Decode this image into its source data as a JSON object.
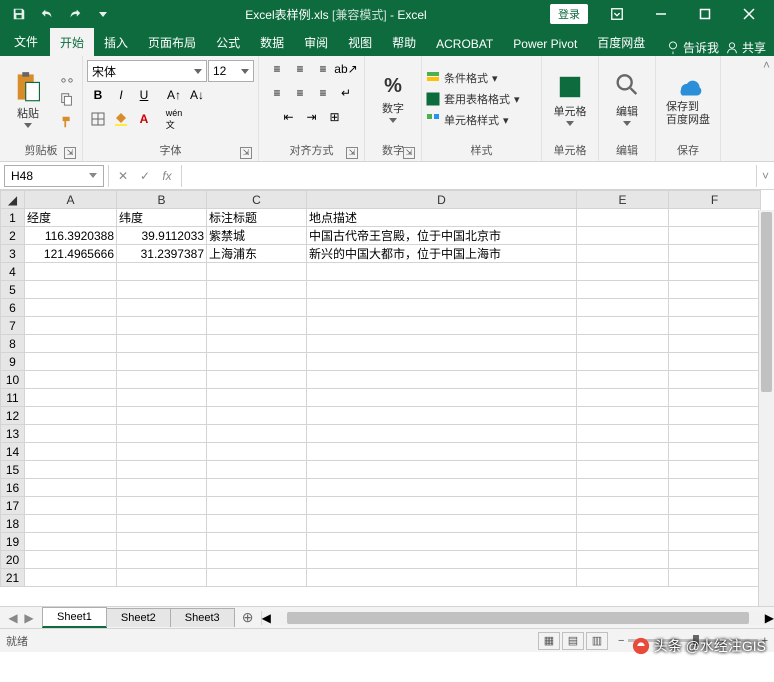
{
  "title": {
    "filename": "Excel表样例.xls",
    "mode": "[兼容模式]",
    "app": "Excel",
    "login": "登录"
  },
  "tabs": {
    "file": "文件",
    "home": "开始",
    "insert": "插入",
    "layout": "页面布局",
    "formulas": "公式",
    "data": "数据",
    "review": "审阅",
    "view": "视图",
    "help": "帮助",
    "acrobat": "ACROBAT",
    "powerpivot": "Power Pivot",
    "baidu": "百度网盘",
    "tellme": "告诉我",
    "share": "共享"
  },
  "ribbon": {
    "clipboard": {
      "paste": "粘贴",
      "label": "剪贴板"
    },
    "font": {
      "name": "宋体",
      "size": "12",
      "label": "字体"
    },
    "align": {
      "label": "对齐方式"
    },
    "number": {
      "general": "%",
      "label": "数字"
    },
    "styles": {
      "cond": "条件格式",
      "table": "套用表格格式",
      "cell": "单元格样式",
      "label": "样式"
    },
    "cells": {
      "label": "单元格"
    },
    "editing": {
      "label": "编辑"
    },
    "save": {
      "btn": "保存到\n百度网盘",
      "label": "保存"
    }
  },
  "formula_bar": {
    "name_box": "H48"
  },
  "columns": [
    "A",
    "B",
    "C",
    "D",
    "E",
    "F"
  ],
  "rows": [
    {
      "r": 1,
      "A": "经度",
      "B": "纬度",
      "C": "标注标题",
      "D": "地点描述"
    },
    {
      "r": 2,
      "A": "116.3920388",
      "B": "39.9112033",
      "C": "紫禁城",
      "D": "中国古代帝王宫殿，位于中国北京市",
      "numA": true,
      "numB": true
    },
    {
      "r": 3,
      "A": "121.4965666",
      "B": "31.2397387",
      "C": "上海浦东",
      "D": "新兴的中国大都市，位于中国上海市",
      "numA": true,
      "numB": true
    }
  ],
  "sheets": {
    "s1": "Sheet1",
    "s2": "Sheet2",
    "s3": "Sheet3"
  },
  "status": {
    "ready": "就绪"
  },
  "watermark": "头条 @水经注GIS"
}
